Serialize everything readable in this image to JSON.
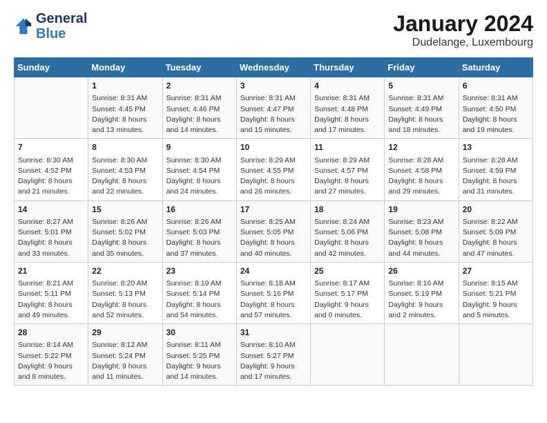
{
  "header": {
    "logo_general": "General",
    "logo_blue": "Blue",
    "title": "January 2024",
    "subtitle": "Dudelange, Luxembourg"
  },
  "columns": [
    "Sunday",
    "Monday",
    "Tuesday",
    "Wednesday",
    "Thursday",
    "Friday",
    "Saturday"
  ],
  "weeks": [
    [
      {
        "day": "",
        "content": ""
      },
      {
        "day": "1",
        "content": "Sunrise: 8:31 AM\nSunset: 4:45 PM\nDaylight: 8 hours\nand 13 minutes."
      },
      {
        "day": "2",
        "content": "Sunrise: 8:31 AM\nSunset: 4:46 PM\nDaylight: 8 hours\nand 14 minutes."
      },
      {
        "day": "3",
        "content": "Sunrise: 8:31 AM\nSunset: 4:47 PM\nDaylight: 8 hours\nand 15 minutes."
      },
      {
        "day": "4",
        "content": "Sunrise: 8:31 AM\nSunset: 4:48 PM\nDaylight: 8 hours\nand 17 minutes."
      },
      {
        "day": "5",
        "content": "Sunrise: 8:31 AM\nSunset: 4:49 PM\nDaylight: 8 hours\nand 18 minutes."
      },
      {
        "day": "6",
        "content": "Sunrise: 8:31 AM\nSunset: 4:50 PM\nDaylight: 8 hours\nand 19 minutes."
      }
    ],
    [
      {
        "day": "7",
        "content": "Sunrise: 8:30 AM\nSunset: 4:52 PM\nDaylight: 8 hours\nand 21 minutes."
      },
      {
        "day": "8",
        "content": "Sunrise: 8:30 AM\nSunset: 4:53 PM\nDaylight: 8 hours\nand 22 minutes."
      },
      {
        "day": "9",
        "content": "Sunrise: 8:30 AM\nSunset: 4:54 PM\nDaylight: 8 hours\nand 24 minutes."
      },
      {
        "day": "10",
        "content": "Sunrise: 8:29 AM\nSunset: 4:55 PM\nDaylight: 8 hours\nand 26 minutes."
      },
      {
        "day": "11",
        "content": "Sunrise: 8:29 AM\nSunset: 4:57 PM\nDaylight: 8 hours\nand 27 minutes."
      },
      {
        "day": "12",
        "content": "Sunrise: 8:28 AM\nSunset: 4:58 PM\nDaylight: 8 hours\nand 29 minutes."
      },
      {
        "day": "13",
        "content": "Sunrise: 8:28 AM\nSunset: 4:59 PM\nDaylight: 8 hours\nand 31 minutes."
      }
    ],
    [
      {
        "day": "14",
        "content": "Sunrise: 8:27 AM\nSunset: 5:01 PM\nDaylight: 8 hours\nand 33 minutes."
      },
      {
        "day": "15",
        "content": "Sunrise: 8:26 AM\nSunset: 5:02 PM\nDaylight: 8 hours\nand 35 minutes."
      },
      {
        "day": "16",
        "content": "Sunrise: 8:26 AM\nSunset: 5:03 PM\nDaylight: 8 hours\nand 37 minutes."
      },
      {
        "day": "17",
        "content": "Sunrise: 8:25 AM\nSunset: 5:05 PM\nDaylight: 8 hours\nand 40 minutes."
      },
      {
        "day": "18",
        "content": "Sunrise: 8:24 AM\nSunset: 5:06 PM\nDaylight: 8 hours\nand 42 minutes."
      },
      {
        "day": "19",
        "content": "Sunrise: 8:23 AM\nSunset: 5:08 PM\nDaylight: 8 hours\nand 44 minutes."
      },
      {
        "day": "20",
        "content": "Sunrise: 8:22 AM\nSunset: 5:09 PM\nDaylight: 8 hours\nand 47 minutes."
      }
    ],
    [
      {
        "day": "21",
        "content": "Sunrise: 8:21 AM\nSunset: 5:11 PM\nDaylight: 8 hours\nand 49 minutes."
      },
      {
        "day": "22",
        "content": "Sunrise: 8:20 AM\nSunset: 5:13 PM\nDaylight: 8 hours\nand 52 minutes."
      },
      {
        "day": "23",
        "content": "Sunrise: 8:19 AM\nSunset: 5:14 PM\nDaylight: 8 hours\nand 54 minutes."
      },
      {
        "day": "24",
        "content": "Sunrise: 8:18 AM\nSunset: 5:16 PM\nDaylight: 8 hours\nand 57 minutes."
      },
      {
        "day": "25",
        "content": "Sunrise: 8:17 AM\nSunset: 5:17 PM\nDaylight: 9 hours\nand 0 minutes."
      },
      {
        "day": "26",
        "content": "Sunrise: 8:16 AM\nSunset: 5:19 PM\nDaylight: 9 hours\nand 2 minutes."
      },
      {
        "day": "27",
        "content": "Sunrise: 8:15 AM\nSunset: 5:21 PM\nDaylight: 9 hours\nand 5 minutes."
      }
    ],
    [
      {
        "day": "28",
        "content": "Sunrise: 8:14 AM\nSunset: 5:22 PM\nDaylight: 9 hours\nand 8 minutes."
      },
      {
        "day": "29",
        "content": "Sunrise: 8:12 AM\nSunset: 5:24 PM\nDaylight: 9 hours\nand 11 minutes."
      },
      {
        "day": "30",
        "content": "Sunrise: 8:11 AM\nSunset: 5:25 PM\nDaylight: 9 hours\nand 14 minutes."
      },
      {
        "day": "31",
        "content": "Sunrise: 8:10 AM\nSunset: 5:27 PM\nDaylight: 9 hours\nand 17 minutes."
      },
      {
        "day": "",
        "content": ""
      },
      {
        "day": "",
        "content": ""
      },
      {
        "day": "",
        "content": ""
      }
    ]
  ]
}
